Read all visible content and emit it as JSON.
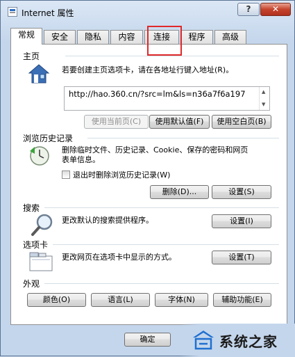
{
  "window": {
    "title": "Internet 属性",
    "help_label": "?",
    "close_label": "✕"
  },
  "tabs": [
    {
      "label": "常规",
      "active": true
    },
    {
      "label": "安全"
    },
    {
      "label": "隐私"
    },
    {
      "label": "内容"
    },
    {
      "label": "连接"
    },
    {
      "label": "程序"
    },
    {
      "label": "高级"
    }
  ],
  "home": {
    "section": "主页",
    "description": "若要创建主页选项卡，请在各地址行键入地址(R)。",
    "url": "http://hao.360.cn/?src=lm&ls=n36a7f6a197",
    "use_current": "使用当前页(C)",
    "use_default": "使用默认值(F)",
    "use_blank": "使用空白页(B)"
  },
  "history": {
    "section": "浏览历史记录",
    "description_line1": "删除临时文件、历史记录、Cookie、保存的密码和网页",
    "description_line2": "表单信息。",
    "checkbox_label": "退出时删除浏览历史记录(W)",
    "delete": "删除(D)...",
    "settings": "设置(S)"
  },
  "search": {
    "section": "搜索",
    "description": "更改默认的搜索提供程序。",
    "settings": "设置(I)"
  },
  "tabs_section": {
    "section": "选项卡",
    "description": "更改网页在选项卡中显示的方式。",
    "settings": "设置(T)"
  },
  "appearance": {
    "section": "外观",
    "colors": "颜色(O)",
    "languages": "语言(L)",
    "fonts": "字体(N)",
    "accessibility": "辅助功能(E)"
  },
  "footer": {
    "ok": "确定"
  },
  "watermark": {
    "text": "系统之家"
  },
  "colors": {
    "highlight": "#e0282a",
    "accent": "#2d6fc4"
  }
}
